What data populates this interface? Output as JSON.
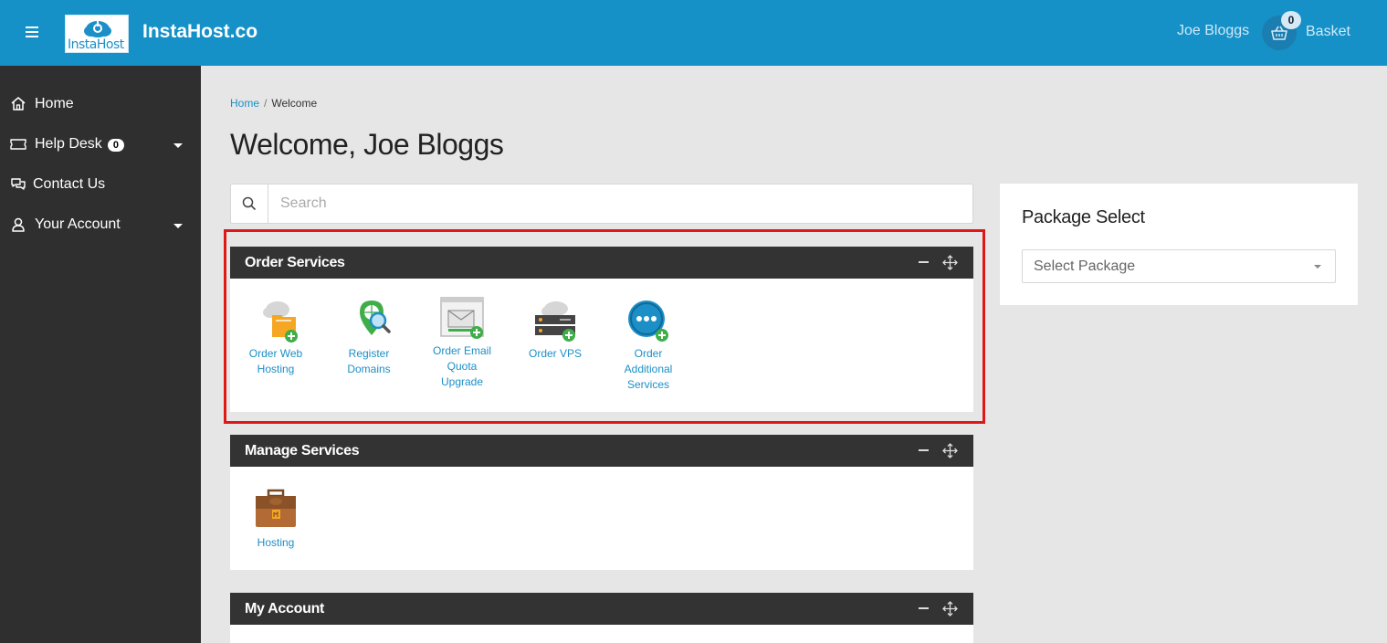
{
  "header": {
    "logo_text": "InstaHost",
    "brand": "InstaHost.co",
    "user_name": "Joe Bloggs",
    "basket_count": "0",
    "basket_label": "Basket"
  },
  "sidebar": {
    "items": [
      {
        "label": "Home",
        "icon": "home-icon"
      },
      {
        "label": "Help Desk",
        "icon": "ticket-icon",
        "badge": "0",
        "has_caret": true
      },
      {
        "label": "Contact Us",
        "icon": "chat-icon"
      },
      {
        "label": "Your Account",
        "icon": "user-icon",
        "has_caret": true
      }
    ]
  },
  "breadcrumb": {
    "home": "Home",
    "separator": "/",
    "current": "Welcome"
  },
  "page_title": "Welcome, Joe Bloggs",
  "search": {
    "placeholder": "Search"
  },
  "panels": {
    "order_services": {
      "title": "Order Services",
      "tiles": [
        {
          "label_lines": [
            "Order Web",
            "Hosting"
          ],
          "icon": "web-hosting-icon"
        },
        {
          "label_lines": [
            "Register",
            "Domains"
          ],
          "icon": "domain-search-icon"
        },
        {
          "label_lines": [
            "Order Email",
            "Quota",
            "Upgrade"
          ],
          "icon": "email-upgrade-icon"
        },
        {
          "label_lines": [
            "Order VPS"
          ],
          "icon": "vps-server-icon"
        },
        {
          "label_lines": [
            "Order",
            "Additional",
            "Services"
          ],
          "icon": "more-services-icon"
        }
      ]
    },
    "manage_services": {
      "title": "Manage Services",
      "tiles": [
        {
          "label_lines": [
            "Hosting"
          ],
          "icon": "briefcase-icon"
        }
      ]
    },
    "my_account": {
      "title": "My Account"
    }
  },
  "package_select": {
    "title": "Package Select",
    "placeholder": "Select Package"
  },
  "colors": {
    "header_bg": "#1591c8",
    "sidebar_bg": "#2f2f2f",
    "panel_head_bg": "#343333",
    "link": "#1c8fc7",
    "highlight": "#e01717",
    "add_badge": "#3fae49"
  }
}
